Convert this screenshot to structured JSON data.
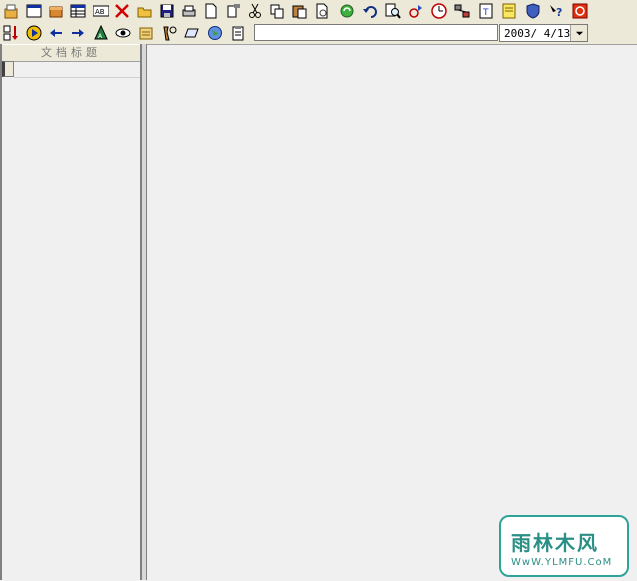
{
  "toolbar_row1": [
    {
      "name": "open-db-icon"
    },
    {
      "name": "new-window-icon"
    },
    {
      "name": "package-icon"
    },
    {
      "name": "table-view-icon"
    },
    {
      "name": "ab-text-icon"
    },
    {
      "name": "delete-icon"
    },
    {
      "name": "open-folder-icon"
    },
    {
      "name": "save-icon"
    },
    {
      "name": "print-icon"
    },
    {
      "name": "new-document-icon"
    },
    {
      "name": "properties-icon"
    },
    {
      "name": "cut-icon"
    },
    {
      "name": "copy-icon"
    },
    {
      "name": "paste-icon"
    },
    {
      "name": "page-setup-icon"
    },
    {
      "name": "recycle-icon"
    },
    {
      "name": "undo-icon"
    },
    {
      "name": "find-icon"
    },
    {
      "name": "replace-icon"
    },
    {
      "name": "clock-icon"
    },
    {
      "name": "connect-icon"
    },
    {
      "name": "text-icon"
    },
    {
      "name": "note-icon"
    },
    {
      "name": "shield-icon"
    },
    {
      "name": "help-icon"
    },
    {
      "name": "exit-icon"
    }
  ],
  "toolbar_row2": [
    {
      "name": "sort-icon"
    },
    {
      "name": "play-icon"
    },
    {
      "name": "back-arrow-icon"
    },
    {
      "name": "forward-arrow-icon"
    },
    {
      "name": "tree-icon"
    },
    {
      "name": "eye-icon"
    },
    {
      "name": "list-icon"
    },
    {
      "name": "tools-icon"
    },
    {
      "name": "eraser-icon"
    },
    {
      "name": "globe-icon"
    },
    {
      "name": "clipboard-icon"
    }
  ],
  "text_field": {
    "value": ""
  },
  "date_combo": {
    "value": "2003/ 4/13"
  },
  "left_pane": {
    "column_header": "文档标题"
  },
  "watermark": {
    "title": "雨林木风",
    "subtitle": "WwW.YLMFU.CoM",
    "accent": "#2fa398"
  },
  "colors": {
    "toolbar": "#ece9d8",
    "pane": "#f0f0f0"
  }
}
